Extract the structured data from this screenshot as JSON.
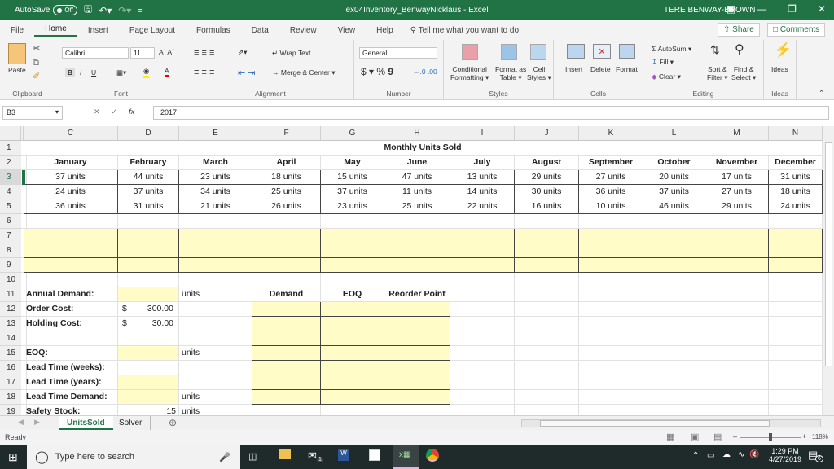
{
  "titlebar": {
    "autosave_label": "AutoSave",
    "autosave_state": "Off",
    "document_title": "ex04Inventory_BenwayNicklaus  -  Excel",
    "user_name": "TERE BENWAY-BROWN"
  },
  "menu": {
    "tabs": [
      "File",
      "Home",
      "Insert",
      "Page Layout",
      "Formulas",
      "Data",
      "Review",
      "View",
      "Help"
    ],
    "active_tab": "Home",
    "tell_me_placeholder": "Tell me what you want to do",
    "share_label": "Share",
    "comments_label": "Comments"
  },
  "ribbon": {
    "clipboard": {
      "paste": "Paste",
      "label": "Clipboard"
    },
    "font": {
      "name": "Calibri",
      "size": "11",
      "label": "Font",
      "bold": "B",
      "italic": "I",
      "underline": "U"
    },
    "alignment": {
      "wrap_text": "Wrap Text",
      "merge_center": "Merge & Center",
      "label": "Alignment"
    },
    "number": {
      "format": "General",
      "label": "Number",
      "currency": "$",
      "percent": "%",
      "comma": "9"
    },
    "styles": {
      "conditional": "Conditional",
      "conditional2": "Formatting",
      "format_as": "Format as",
      "format_as2": "Table",
      "cell": "Cell",
      "cell2": "Styles",
      "label": "Styles"
    },
    "cells": {
      "insert": "Insert",
      "delete": "Delete",
      "format": "Format",
      "label": "Cells"
    },
    "editing": {
      "autosum": "AutoSum",
      "fill": "Fill",
      "clear": "Clear",
      "sort": "Sort &",
      "sort2": "Filter",
      "find": "Find &",
      "find2": "Select",
      "label": "Editing"
    },
    "ideas": {
      "button": "Ideas",
      "label": "Ideas"
    }
  },
  "formula_bar": {
    "name_box": "B3",
    "formula": "2017"
  },
  "columns": [
    "C",
    "D",
    "E",
    "F",
    "G",
    "H",
    "I",
    "J",
    "K",
    "L",
    "M",
    "N"
  ],
  "rows": [
    "1",
    "2",
    "3",
    "4",
    "5",
    "6",
    "7",
    "8",
    "9",
    "10",
    "11",
    "12",
    "13",
    "14",
    "15",
    "16",
    "17",
    "18",
    "19"
  ],
  "sheet": {
    "title": "Monthly Units Sold",
    "months": [
      "January",
      "February",
      "March",
      "April",
      "May",
      "June",
      "July",
      "August",
      "September",
      "October",
      "November",
      "December"
    ],
    "units": [
      [
        "37 units",
        "44 units",
        "23 units",
        "18 units",
        "15 units",
        "47 units",
        "13 units",
        "29 units",
        "27 units",
        "20 units",
        "17 units",
        "31 units"
      ],
      [
        "24 units",
        "37 units",
        "34 units",
        "25 units",
        "37 units",
        "11 units",
        "14 units",
        "30 units",
        "36 units",
        "37 units",
        "27 units",
        "18 units"
      ],
      [
        "36 units",
        "31 units",
        "21 units",
        "26 units",
        "23 units",
        "25 units",
        "22 units",
        "16 units",
        "10 units",
        "46 units",
        "29 units",
        "24 units"
      ]
    ],
    "labels": {
      "annual_demand": "Annual Demand:",
      "order_cost": "Order Cost:",
      "holding_cost": "Holding Cost:",
      "eoq": "EOQ:",
      "lead_time_weeks": "Lead Time (weeks):",
      "lead_time_years": "Lead Time (years):",
      "lead_time_demand": "Lead Time Demand:",
      "safety_stock": "Safety Stock:"
    },
    "values": {
      "order_cost_symbol": "$",
      "order_cost": "300.00",
      "holding_cost_symbol": "$",
      "holding_cost": "30.00",
      "safety_stock": "15",
      "units": "units"
    },
    "table_headers": [
      "Demand",
      "EOQ",
      "Reorder Point"
    ]
  },
  "sheet_tabs": [
    "UnitsSold",
    "Solver"
  ],
  "active_sheet": "UnitsSold",
  "status": {
    "mode": "Ready",
    "zoom": "118%"
  },
  "taskbar": {
    "search_placeholder": "Type here to search",
    "time": "1:29 PM",
    "date": "4/27/2019",
    "notifications": "6",
    "mail_badge": "1"
  }
}
